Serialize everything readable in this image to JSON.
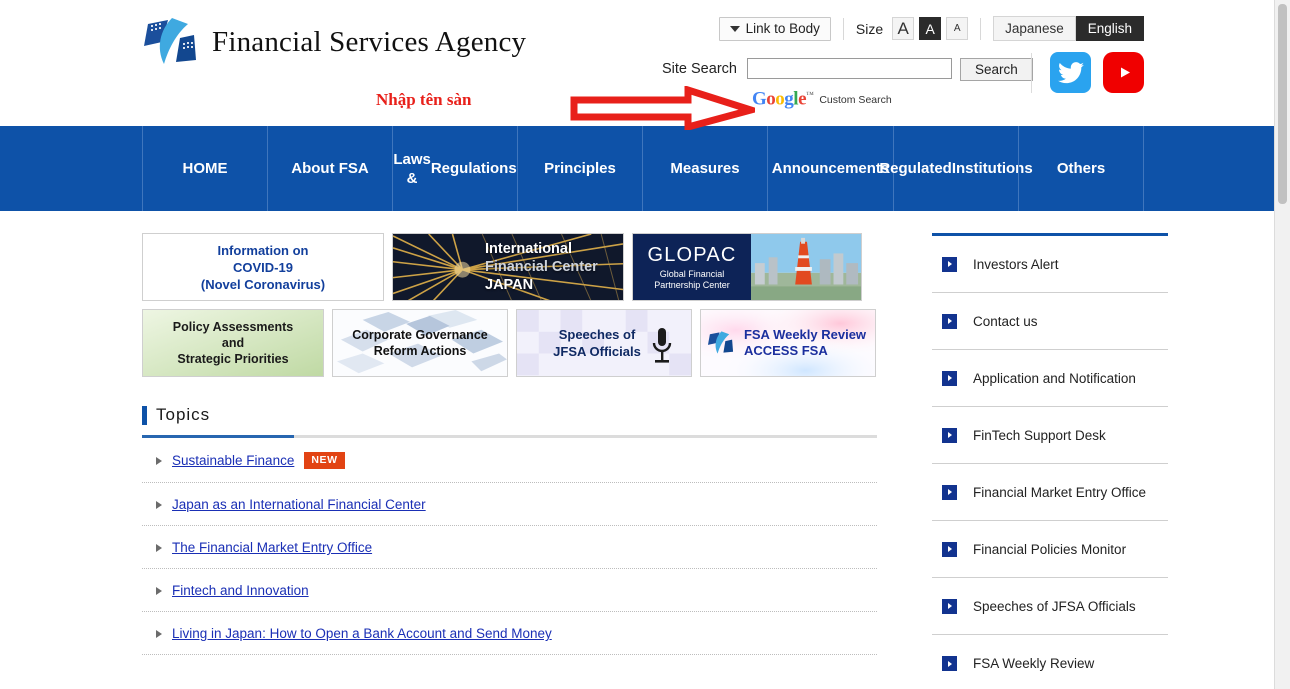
{
  "header": {
    "site_name": "Financial Services Agency",
    "logo_icon": "fsa-logo-icon",
    "annotation_text": "Nhập tên sàn",
    "annotation_arrow_icon": "red-right-arrow-icon",
    "link_to_body": "Link to Body",
    "size_label": "Size",
    "size_options": [
      {
        "label": "A",
        "size": "large",
        "active": false
      },
      {
        "label": "A",
        "size": "medium",
        "active": true
      },
      {
        "label": "A",
        "size": "small",
        "active": false
      }
    ],
    "languages": [
      {
        "label": "Japanese",
        "active": false
      },
      {
        "label": "English",
        "active": true
      }
    ],
    "search": {
      "label": "Site Search",
      "value": "",
      "placeholder": "",
      "button": "Search",
      "provider_brand": "Google",
      "provider_tm": "™",
      "provider_suffix": "Custom Search",
      "google_letters": [
        {
          "ch": "G",
          "color": "#4285F4"
        },
        {
          "ch": "o",
          "color": "#EA4335"
        },
        {
          "ch": "o",
          "color": "#FBBC05"
        },
        {
          "ch": "g",
          "color": "#4285F4"
        },
        {
          "ch": "l",
          "color": "#34A853"
        },
        {
          "ch": "e",
          "color": "#EA4335"
        }
      ]
    },
    "social": [
      {
        "name": "twitter-icon",
        "label": "Twitter",
        "color": "#2aa3ef"
      },
      {
        "name": "youtube-icon",
        "label": "YouTube",
        "color": "#f00000"
      }
    ]
  },
  "nav": {
    "background": "#0e52a8",
    "items": [
      {
        "label": "HOME"
      },
      {
        "label": "About FSA"
      },
      {
        "label": "Laws &\nRegulations"
      },
      {
        "label": "Principles"
      },
      {
        "label": "Measures"
      },
      {
        "label": "Announcements"
      },
      {
        "label": "Regulated\nInstitutions"
      },
      {
        "label": "Others"
      }
    ]
  },
  "banners": {
    "row1": [
      {
        "name": "banner-covid19",
        "lines": [
          "Information on",
          "COVID-19",
          "(Novel Coronavirus)"
        ],
        "text_color": "#123f9c"
      },
      {
        "name": "banner-international-financial-center-japan",
        "lines": [
          "International",
          "Financial Center",
          "JAPAN"
        ]
      },
      {
        "name": "banner-glopac",
        "title": "GLOPAC",
        "subtitle": [
          "Global Financial",
          "Partnership Center"
        ]
      }
    ],
    "row2": [
      {
        "name": "banner-policy-assessments",
        "lines": [
          "Policy Assessments",
          "and",
          "Strategic Priorities"
        ]
      },
      {
        "name": "banner-corporate-governance",
        "lines": [
          "Corporate Governance",
          "Reform Actions"
        ]
      },
      {
        "name": "banner-speeches-jfsa-officials",
        "lines": [
          "Speeches of",
          "JFSA Officials"
        ],
        "icon": "microphone-icon"
      },
      {
        "name": "banner-fsa-weekly-review",
        "lines": [
          "FSA Weekly Review",
          "ACCESS FSA"
        ],
        "icon": "fsa-logo-icon"
      }
    ]
  },
  "topics": {
    "title": "Topics",
    "items": [
      {
        "label": "Sustainable Finance",
        "badge": "NEW"
      },
      {
        "label": "Japan as an International Financial Center",
        "badge": ""
      },
      {
        "label": "The Financial Market Entry Office",
        "badge": ""
      },
      {
        "label": "Fintech and Innovation",
        "badge": ""
      },
      {
        "label": "Living in Japan: How to Open a Bank Account and Send Money",
        "badge": ""
      }
    ]
  },
  "sidebar": {
    "items": [
      {
        "label": "Investors Alert"
      },
      {
        "label": "Contact us"
      },
      {
        "label": "Application and Notification"
      },
      {
        "label": "FinTech Support Desk"
      },
      {
        "label": "Financial Market Entry Office"
      },
      {
        "label": "Financial Policies Monitor"
      },
      {
        "label": "Speeches of JFSA Officials"
      },
      {
        "label": "FSA Weekly Review"
      }
    ]
  }
}
